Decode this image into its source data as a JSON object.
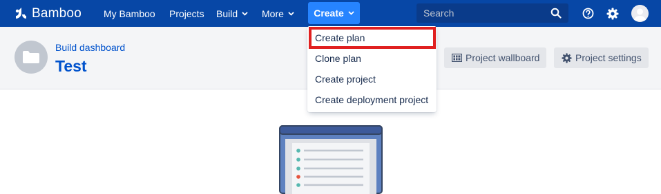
{
  "app": {
    "name": "Bamboo"
  },
  "nav": {
    "items": [
      {
        "label": "My Bamboo",
        "has_menu": false
      },
      {
        "label": "Projects",
        "has_menu": false
      },
      {
        "label": "Build",
        "has_menu": true
      },
      {
        "label": "More",
        "has_menu": true
      }
    ],
    "create_label": "Create"
  },
  "search": {
    "placeholder": "Search"
  },
  "header": {
    "breadcrumb": "Build dashboard",
    "title": "Test",
    "buttons": {
      "wallboard": "Project wallboard",
      "settings": "Project settings"
    }
  },
  "create_menu": {
    "items": [
      "Create plan",
      "Clone plan",
      "Create project",
      "Create deployment project"
    ],
    "highlighted": "Create plan"
  },
  "colors": {
    "nav_bg": "#0747a6",
    "create_bg": "#2684ff",
    "link": "#0052cc",
    "highlight_border": "#e02020"
  },
  "icons": [
    "bamboo-logo-icon",
    "chevron-down-icon",
    "search-icon",
    "help-icon",
    "gear-icon",
    "avatar-icon",
    "folder-icon",
    "wallboard-icon",
    "settings-icon"
  ]
}
